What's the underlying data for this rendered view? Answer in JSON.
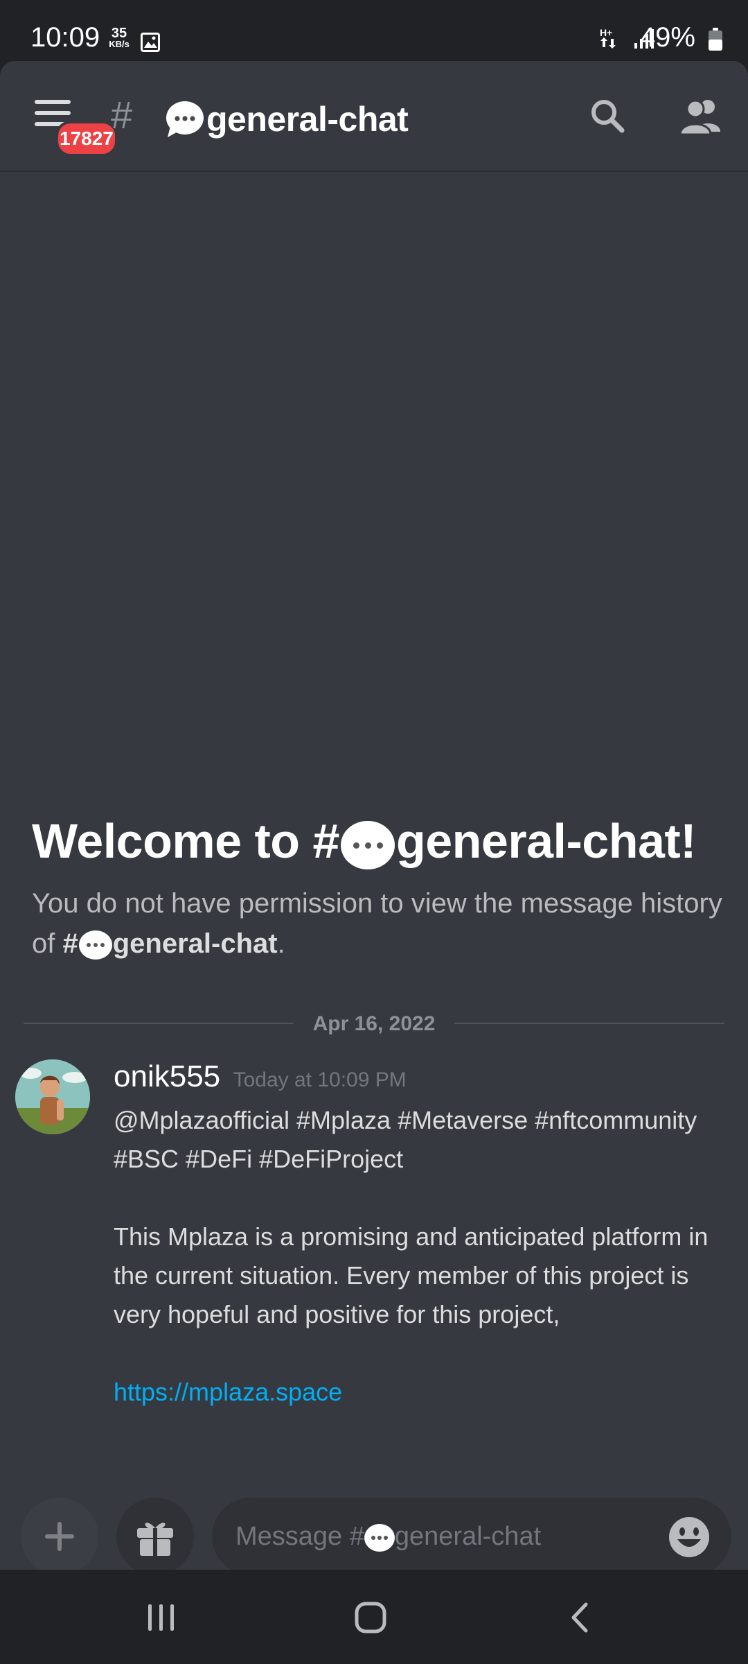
{
  "status_bar": {
    "time": "10:09",
    "net_speed_value": "35",
    "net_speed_unit": "KB/s",
    "battery_text": "49%"
  },
  "header": {
    "unread_badge": "17827",
    "channel_hash": "#",
    "channel_name": "general-chat"
  },
  "welcome": {
    "title_prefix": "Welcome to #",
    "title_channel": "general-chat!",
    "subtitle_prefix": "You do not have permission to view the message history of ",
    "subtitle_hash": "#",
    "subtitle_channel": "general-chat",
    "subtitle_suffix": "."
  },
  "divider_date": "Apr 16, 2022",
  "message": {
    "username": "onik555",
    "timestamp": "Today at 10:09 PM",
    "line1": "@Mplazaofficial #Mplaza #Metaverse #nftcommunity #BSC  #DeFi #DeFiProject",
    "line2": "This Mplaza is a promising and anticipated platform in the current situation. Every member of this project is very hopeful and positive for this project,",
    "link": "https://mplaza.space"
  },
  "composer": {
    "placeholder_prefix": "Message #",
    "placeholder_channel": "general-chat"
  },
  "colors": {
    "background": "#36393f",
    "header": "#36393f",
    "status_bar": "#202225",
    "badge": "#ed4245",
    "link": "#00aff4"
  },
  "icons": [
    "menu-icon",
    "search-icon",
    "members-icon",
    "speech-bubble-icon",
    "plus-icon",
    "gift-icon",
    "emoji-icon",
    "recent-apps-icon",
    "home-icon",
    "back-icon",
    "image-icon",
    "signal-icon",
    "battery-icon"
  ]
}
